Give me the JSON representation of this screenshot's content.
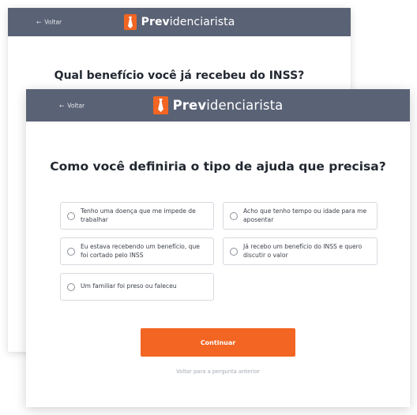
{
  "back_screen": {
    "back_label": "Voltar",
    "brand_bold": "Prev",
    "brand_rest": "idenciarista",
    "question": "Qual benefício você já recebeu do INSS?"
  },
  "front_screen": {
    "back_label": "Voltar",
    "brand_bold": "Prev",
    "brand_rest": "idenciarista",
    "question": "Como você definiria o tipo de ajuda que precisa?",
    "options": [
      "Tenho uma doença que me impede de trabalhar",
      "Acho que tenho tempo ou idade para me aposentar",
      "Eu estava recebendo um benefício, que foi cortado pelo INSS",
      "Já recebo um benefício do INSS e quero discutir o valor",
      "Um familiar foi preso ou faleceu"
    ],
    "continue_label": "Continuar",
    "previous_link": "Voltar para a pergunta anterior"
  },
  "colors": {
    "header": "#5a6275",
    "accent": "#f26522"
  }
}
